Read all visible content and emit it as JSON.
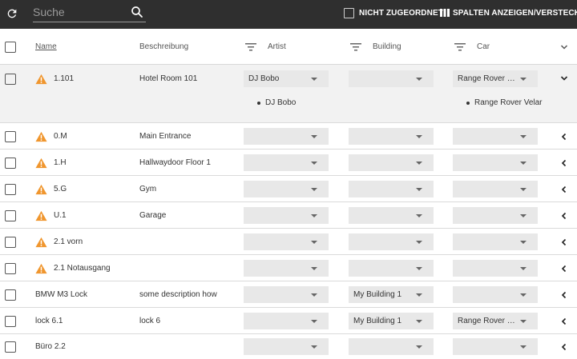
{
  "toolbar": {
    "refresh_icon": "refresh-icon",
    "search_placeholder": "Suche",
    "search_icon": "search-icon",
    "unassigned_label": "NICHT ZUGEORDNET",
    "columns_label": "SPALTEN ANZEIGEN/VERSTECKEN",
    "columns_icon": "columns-icon"
  },
  "header": {
    "name": "Name",
    "description": "Beschreibung",
    "artist": "Artist",
    "building": "Building",
    "car": "Car"
  },
  "colors": {
    "toolbar_bg": "#2f2f2f",
    "warning": "#f0962e",
    "select_bg": "#e8e8e8",
    "expanded_row_bg": "#f2f2f2"
  },
  "rows": [
    {
      "name": "1.101",
      "warning": true,
      "description": "Hotel Room 101",
      "artist": "DJ Bobo",
      "building": "",
      "car": "Range Rover Velar",
      "expanded": true,
      "artist_list": [
        "DJ Bobo"
      ],
      "car_list": [
        "Range Rover Velar"
      ]
    },
    {
      "name": "0.M",
      "warning": true,
      "description": "Main Entrance",
      "artist": "",
      "building": "",
      "car": ""
    },
    {
      "name": "1.H",
      "warning": true,
      "description": "Hallwaydoor Floor 1",
      "artist": "",
      "building": "",
      "car": ""
    },
    {
      "name": "5.G",
      "warning": true,
      "description": "Gym",
      "artist": "",
      "building": "",
      "car": ""
    },
    {
      "name": "U.1",
      "warning": true,
      "description": "Garage",
      "artist": "",
      "building": "",
      "car": ""
    },
    {
      "name": "2.1 vorn",
      "warning": true,
      "description": "",
      "artist": "",
      "building": "",
      "car": ""
    },
    {
      "name": "2.1 Notausgang",
      "warning": true,
      "description": "",
      "artist": "",
      "building": "",
      "car": ""
    },
    {
      "name": "BMW M3 Lock",
      "warning": false,
      "description": "some description how",
      "artist": "",
      "building": "My Building 1",
      "car": ""
    },
    {
      "name": "lock 6.1",
      "warning": false,
      "description": "lock 6",
      "artist": "",
      "building": "My Building 1",
      "car": "Range Rover Velar"
    },
    {
      "name": "Büro 2.2",
      "warning": false,
      "description": "",
      "artist": "",
      "building": "",
      "car": ""
    }
  ]
}
